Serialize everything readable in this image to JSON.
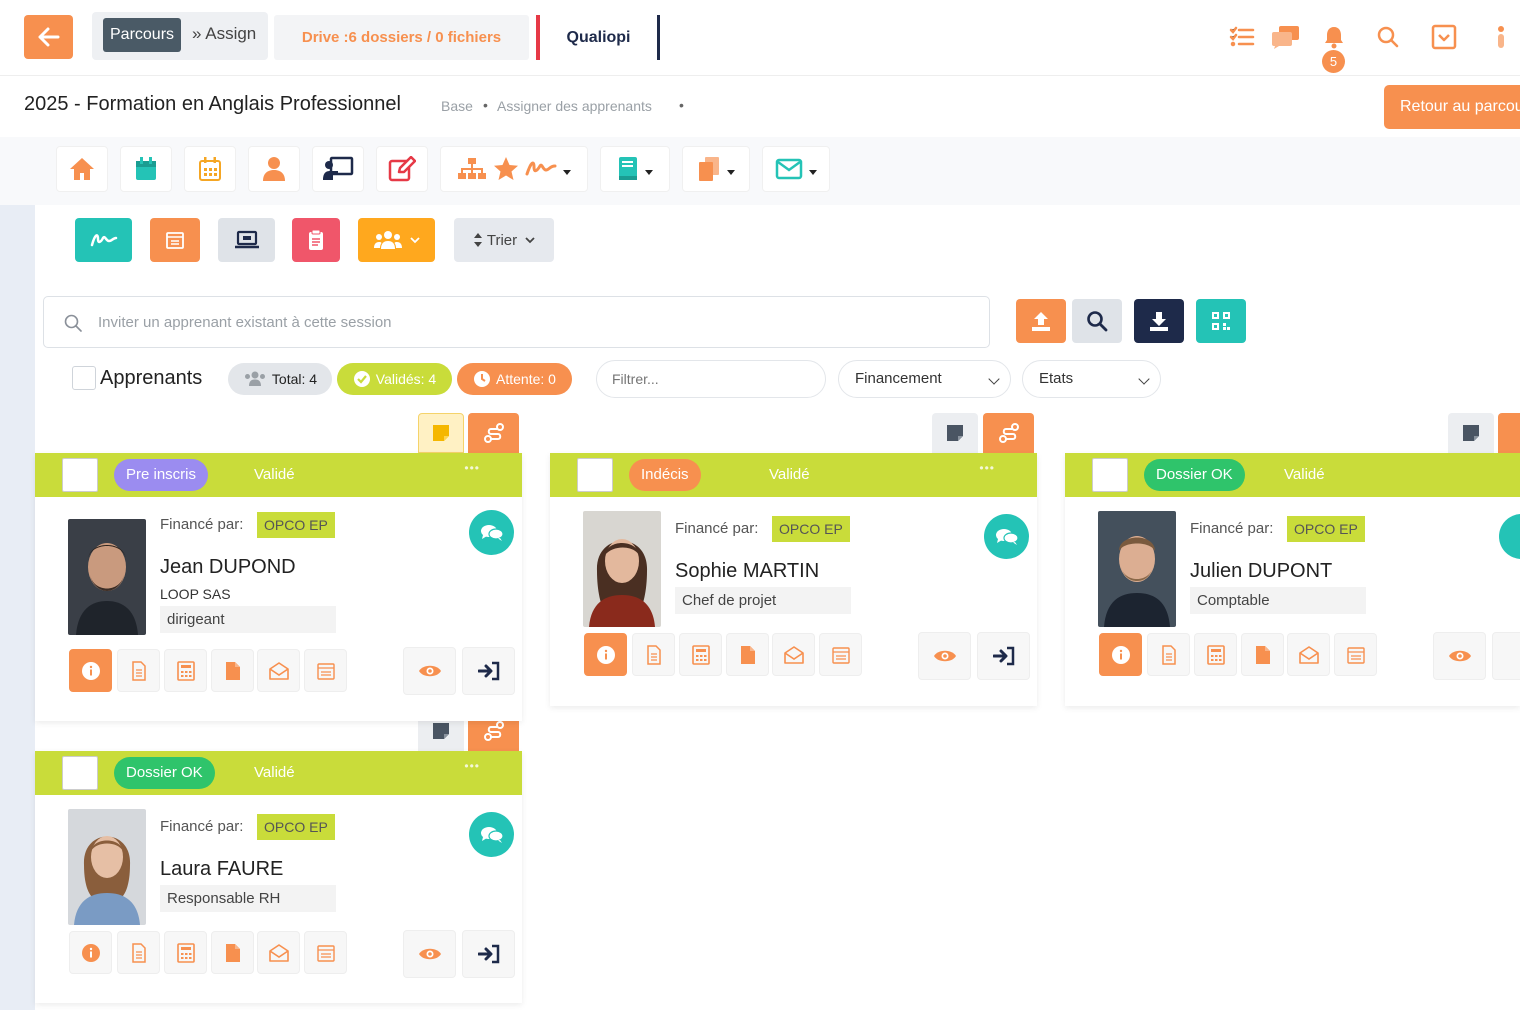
{
  "topbar": {
    "crumb_parcours": "Parcours",
    "crumb_assign": "» Assign",
    "drive": "Drive :6 dossiers / 0 fichiers",
    "qualiopi": "Qualiopi",
    "notifications_count": "5"
  },
  "titlebar": {
    "title": "2025 - Formation en Anglais Professionnel",
    "breadcrumb_base": "Base",
    "breadcrumb_current": "Assigner des apprenants",
    "bullet": "•",
    "retour_button": "Retour au parcours"
  },
  "actions": {
    "trier": "Trier"
  },
  "search": {
    "placeholder": "Inviter un apprenant existant à cette session"
  },
  "filters": {
    "apprenants_label": "Apprenants",
    "total": "Total: 4",
    "valides": "Validés: 4",
    "attente": "Attente: 0",
    "filtrer_placeholder": "Filtrer...",
    "financement": "Financement",
    "etats": "Etats"
  },
  "cards": [
    {
      "status": "Pre inscris",
      "valide": "Validé",
      "dots": "•••",
      "finance_label": "Financé par:",
      "opco": "OPCO EP",
      "name": "Jean DUPOND",
      "company": "LOOP SAS",
      "role": "dirigeant"
    },
    {
      "status": "Indécis",
      "valide": "Validé",
      "dots": "•••",
      "finance_label": "Financé par:",
      "opco": "OPCO EP",
      "name": "Sophie MARTIN",
      "role": "Chef de projet"
    },
    {
      "status": "Dossier OK",
      "valide": "Validé",
      "dots": "•••",
      "finance_label": "Financé par:",
      "opco": "OPCO EP",
      "name": "Julien DUPONT",
      "role": "Comptable"
    },
    {
      "status": "Dossier OK",
      "valide": "Validé",
      "dots": "•••",
      "finance_label": "Financé par:",
      "opco": "OPCO EP",
      "name": "Laura FAURE",
      "role": "Responsable RH"
    }
  ],
  "colors": {
    "accent_orange": "#f7904f",
    "teal": "#24c3b6",
    "lime": "#c9dc3a",
    "navy": "#1e2a4a",
    "red": "#e63946",
    "status_pre_inscris": "#9b8cf0",
    "status_indecis": "#f7904f",
    "status_dossier_ok": "#2fc46b"
  }
}
